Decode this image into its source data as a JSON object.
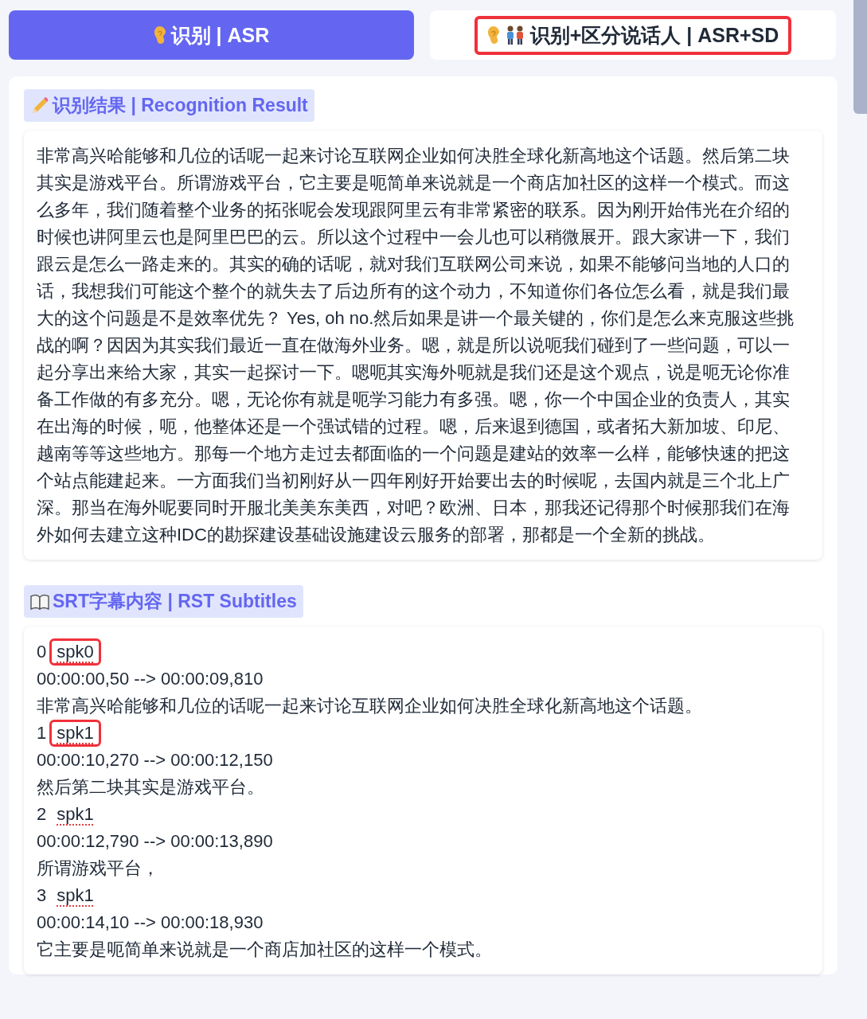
{
  "tabs": [
    {
      "label": "识别 | ASR",
      "kind": "asr",
      "selected": true,
      "highlighted": false
    },
    {
      "label": "识别+区分说话人 | ASR+SD",
      "kind": "diarization",
      "selected": false,
      "highlighted": true
    }
  ],
  "result": {
    "heading": "识别结果 | Recognition Result",
    "text": "非常高兴哈能够和几位的话呢一起来讨论互联网企业如何决胜全球化新高地这个话题。然后第二块其实是游戏平台。所谓游戏平台，它主要是呃简单来说就是一个商店加社区的这样一个模式。而这么多年，我们随着整个业务的拓张呢会发现跟阿里云有非常紧密的联系。因为刚开始伟光在介绍的时候也讲阿里云也是阿里巴巴的云。所以这个过程中一会儿也可以稍微展开。跟大家讲一下，我们跟云是怎么一路走来的。其实的确的话呢，就对我们互联网公司来说，如果不能够问当地的人口的话，我想我们可能这个整个的就失去了后边所有的这个动力，不知道你们各位怎么看，就是我们最大的这个问题是不是效率优先？ Yes, oh no.然后如果是讲一个最关键的，你们是怎么来克服这些挑战的啊？因因为其实我们最近一直在做海外业务。嗯，就是所以说呃我们碰到了一些问题，可以一起分享出来给大家，其实一起探讨一下。嗯呃其实海外呃就是我们还是这个观点，说是呃无论你准备工作做的有多充分。嗯，无论你有就是呃学习能力有多强。嗯，你一个中国企业的负责人，其实在出海的时候，呃，他整体还是一个强试错的过程。嗯，后来退到德国，或者拓大新加坡、印尼、越南等等这些地方。那每一个地方走过去都面临的一个问题是建站的效率一么样，能够快速的把这个站点能建起来。一方面我们当初刚好从一四年刚好开始要出去的时候呢，去国内就是三个北上广深。那当在海外呢要同时开服北美美东美西，对吧？欧洲、日本，那我还记得那个时候那我们在海外如何去建立这种IDC的勘探建设基础设施建设云服务的部署，那都是一个全新的挑战。"
  },
  "subtitles": {
    "heading": "SRT字幕内容 | RST Subtitles",
    "entries": [
      {
        "index": "0",
        "speaker": "spk0",
        "highlighted": true,
        "time": "00:00:00,50 --> 00:00:09,810",
        "text": "非常高兴哈能够和几位的话呢一起来讨论互联网企业如何决胜全球化新高地这个话题。"
      },
      {
        "index": "1",
        "speaker": "spk1",
        "highlighted": true,
        "time": "00:00:10,270 --> 00:00:12,150",
        "text": "然后第二块其实是游戏平台。"
      },
      {
        "index": "2",
        "speaker": "spk1",
        "highlighted": false,
        "time": "00:00:12,790 --> 00:00:13,890",
        "text": "所谓游戏平台，"
      },
      {
        "index": "3",
        "speaker": "spk1",
        "highlighted": false,
        "time": "00:00:14,10 --> 00:00:18,930",
        "text": "它主要是呃简单来说就是一个商店加社区的这样一个模式。"
      }
    ]
  }
}
